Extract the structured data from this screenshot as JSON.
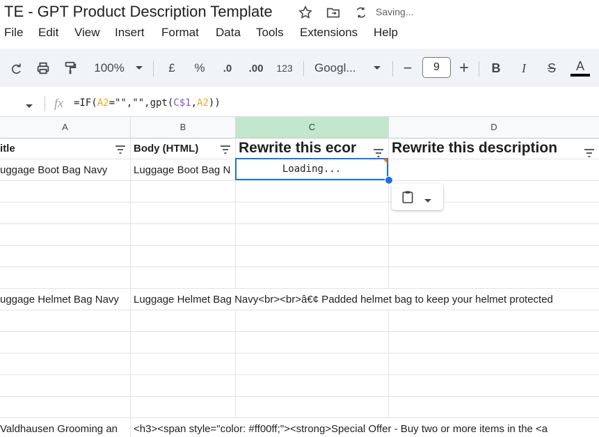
{
  "app": {
    "doc_title": "TE - GPT Product Description Template",
    "save_status": "Saving..."
  },
  "menu": {
    "items": [
      "File",
      "Edit",
      "View",
      "Insert",
      "Format",
      "Data",
      "Tools",
      "Extensions",
      "Help"
    ]
  },
  "toolbar": {
    "zoom": "100%",
    "currency": "£",
    "percent": "%",
    "decrease_decimal": ".0",
    "increase_decimal": ".00",
    "number_format": "123",
    "font": "Googl...",
    "font_size": "9",
    "minus": "−",
    "plus": "+",
    "bold": "B",
    "italic": "I",
    "strike": "S",
    "text_color": "A"
  },
  "formula_bar": {
    "fx": "fx",
    "f1": "=IF(",
    "f2": "A2",
    "f3": "=\"\",\"\",gpt(",
    "f4": "C$1",
    "f5": ",",
    "f6": "A2",
    "f7": "))"
  },
  "columns": [
    "A",
    "B",
    "C",
    "D"
  ],
  "rows": {
    "header": {
      "a": "itle",
      "b": "Body (HTML)",
      "c": "Rewrite this ecor",
      "d": "Rewrite this description"
    },
    "r2": {
      "a": "uggage Boot Bag Navy",
      "b": "Luggage Boot Bag N",
      "c": "Loading..."
    },
    "r8": {
      "a": "uggage Helmet Bag Navy",
      "b": "Luggage Helmet Bag Navy<br><br>â€¢ Padded helmet bag to keep your helmet protected"
    },
    "r14": {
      "a": "Valdhausen Grooming an",
      "b": "<h3><span style=\"color: #ff00ff;\"><strong>Special Offer - Buy two or more items in the <a"
    }
  },
  "colors": {
    "accent": "#1a73e8",
    "selected_col": "#c2e7cc",
    "toolbar_bg": "#f0f4f9"
  }
}
